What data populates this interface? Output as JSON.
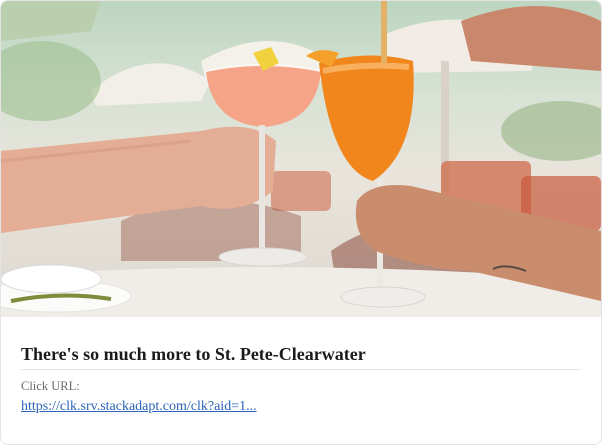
{
  "ad": {
    "image_alt": "Two hands toasting cocktail glasses at an outdoor restaurant",
    "title": "There's so much more to St. Pete-Clearwater",
    "click_label": "Click URL:",
    "click_url": "https://clk.srv.stackadapt.com/clk?aid=1..."
  }
}
